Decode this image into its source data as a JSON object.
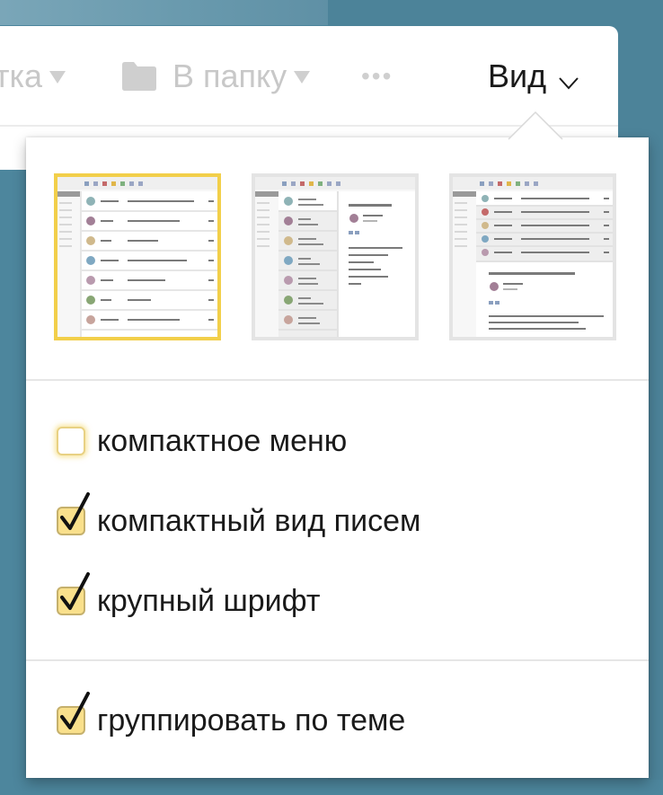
{
  "toolbar": {
    "items": [
      {
        "label": "тка"
      },
      {
        "label": "В папку"
      },
      {
        "label": "•••"
      }
    ],
    "view_label": "Вид"
  },
  "layouts": [
    {
      "name": "list",
      "selected": true
    },
    {
      "name": "two-column",
      "selected": false
    },
    {
      "name": "horizontal-split",
      "selected": false
    }
  ],
  "options": [
    {
      "label": "компактное меню",
      "checked": false
    },
    {
      "label": "компактный вид писем",
      "checked": true
    },
    {
      "label": "крупный шрифт",
      "checked": true
    },
    {
      "label": "группировать по теме",
      "checked": true
    }
  ],
  "colors": {
    "accent": "#f2cf4a",
    "checkbox_fill": "#f9e08c",
    "background": "#4d869d"
  }
}
